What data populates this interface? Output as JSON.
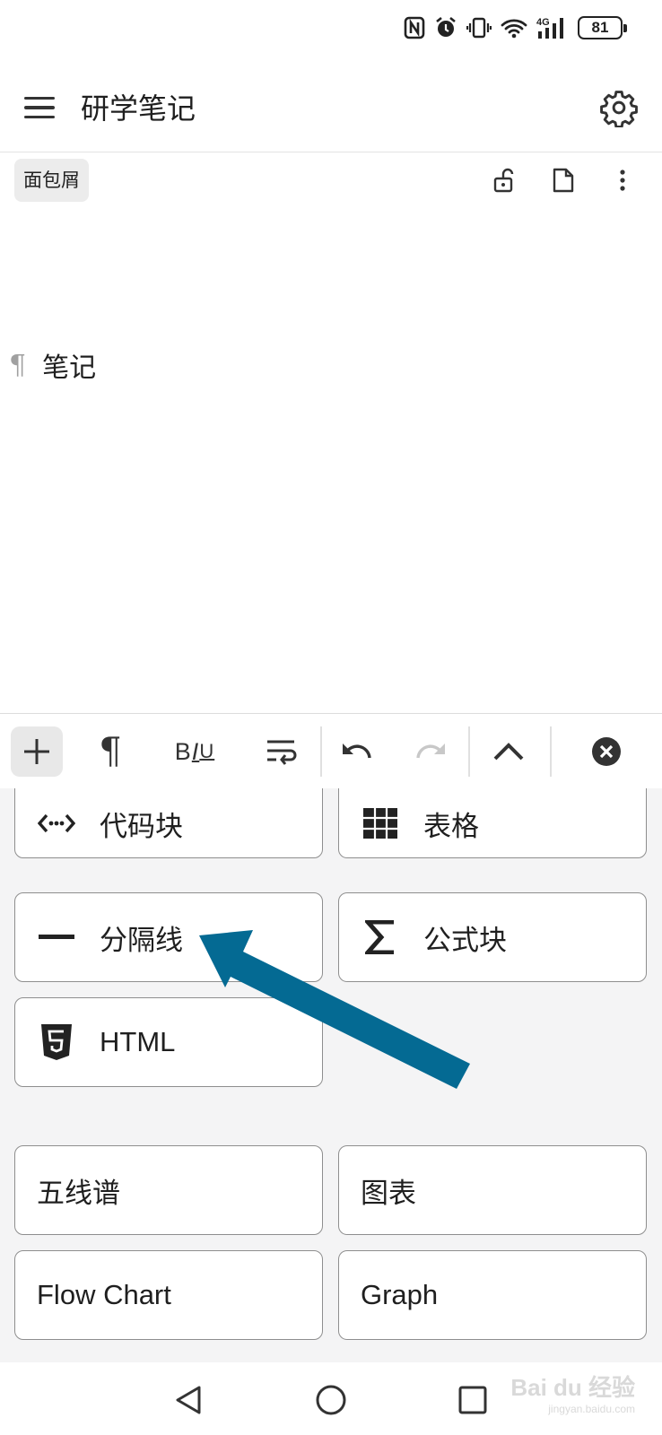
{
  "status_bar": {
    "battery": "81",
    "icons": [
      "nfc-icon",
      "alarm-icon",
      "vibrate-icon",
      "wifi-icon",
      "signal-4g-icon",
      "battery-icon"
    ],
    "network_label": "4G"
  },
  "app_bar": {
    "title": "研学笔记",
    "icons": [
      "menu-icon",
      "settings-icon"
    ]
  },
  "breadcrumb": {
    "label": "面包屑",
    "tools": [
      "unlock-icon",
      "file-icon",
      "more-vert-icon"
    ]
  },
  "editor": {
    "paragraph_mark": "¶",
    "paragraph_text": "笔记"
  },
  "toolbar": {
    "paragraph_glyph": "¶",
    "biu": {
      "b": "B",
      "i": "I",
      "u": "U"
    },
    "icons": [
      "plus-icon",
      "paragraph-icon",
      "text-format-icon",
      "wrap-text-icon",
      "undo-icon",
      "redo-icon",
      "chevron-up-icon",
      "close-circle-icon"
    ],
    "redo_enabled": false
  },
  "panel": {
    "blocks": [
      {
        "label": "代码块",
        "icon": "code-icon"
      },
      {
        "label": "表格",
        "icon": "table-icon"
      },
      {
        "label": "分隔线",
        "icon": "horizontal-rule-icon"
      },
      {
        "label": "公式块",
        "icon": "sigma-icon"
      },
      {
        "label": "HTML",
        "icon": "html5-icon"
      }
    ],
    "diagrams": [
      {
        "label": "五线谱"
      },
      {
        "label": "图表"
      },
      {
        "label": "Flow Chart"
      },
      {
        "label": "Graph"
      }
    ]
  },
  "annotation": {
    "arrow_color": "#046a93"
  },
  "nav_bar": {
    "icons": [
      "back-triangle-icon",
      "home-circle-icon",
      "recents-square-icon"
    ]
  },
  "watermark": {
    "text": "Bai du 经验",
    "sub": "jingyan.baidu.com"
  }
}
